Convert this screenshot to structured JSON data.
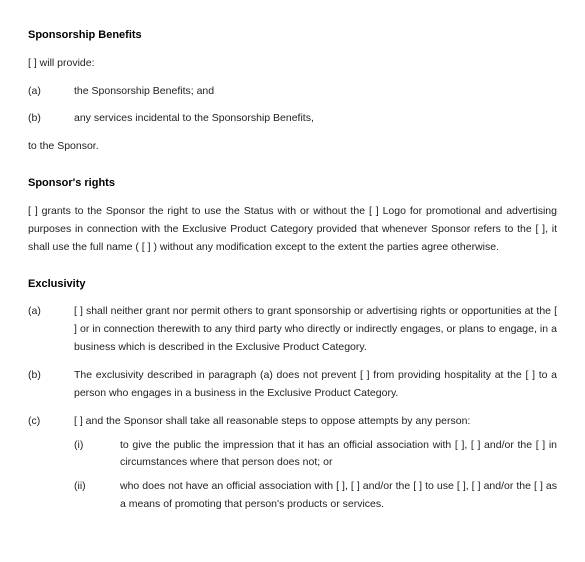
{
  "benefits": {
    "heading": "Sponsorship Benefits",
    "intro": "[ ] will provide:",
    "items": [
      {
        "marker": "(a)",
        "text": "the Sponsorship Benefits; and"
      },
      {
        "marker": "(b)",
        "text": "any services incidental to the Sponsorship Benefits,"
      }
    ],
    "closer": "to the Sponsor."
  },
  "rights": {
    "heading": "Sponsor's rights",
    "body": "[ ] grants to the Sponsor the right to use the Status with or without the [ ] Logo for promotional and advertising purposes in connection with the Exclusive Product Category provided that whenever Sponsor refers to the [ ], it shall use the full name ( [ ] ) without any modification except to the extent the parties agree otherwise."
  },
  "exclusivity": {
    "heading": "Exclusivity",
    "items": [
      {
        "marker": "(a)",
        "text": "[ ] shall neither grant nor permit others to grant sponsorship or advertising rights or opportunities at the [ ] or in connection therewith to any third party who directly or indirectly engages, or plans to engage, in a business which is described in the Exclusive Product Category."
      },
      {
        "marker": "(b)",
        "text": "The exclusivity described in paragraph (a) does not prevent [ ] from providing hospitality at the [ ] to a person who engages in a business in the Exclusive Product Category."
      },
      {
        "marker": "(c)",
        "text": "[ ] and the Sponsor shall take all reasonable steps to oppose attempts by any person:",
        "sub": [
          {
            "marker": "(i)",
            "text": "to give the public the impression that it has an official association with [ ], [ ] and/or the [ ] in circumstances where that person does not; or"
          },
          {
            "marker": "(ii)",
            "text": "who does not have an official association with [ ], [ ] and/or the [ ] to use [ ], [ ] and/or the [ ] as a means of promoting that person's products or services."
          }
        ]
      }
    ]
  }
}
